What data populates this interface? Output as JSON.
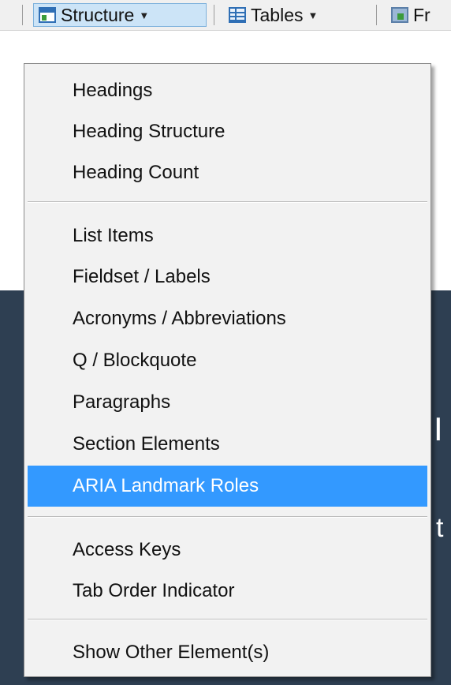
{
  "toolbar": {
    "structure_label": "Structure",
    "tables_label": "Tables",
    "frames_label_partial": "Fr"
  },
  "background": {
    "glyph_1": "I",
    "glyph_2": "t"
  },
  "menu": {
    "group1": [
      "Headings",
      "Heading Structure",
      "Heading Count"
    ],
    "group2": [
      "List Items",
      "Fieldset / Labels",
      "Acronyms / Abbreviations",
      "Q / Blockquote",
      "Paragraphs",
      "Section Elements",
      "ARIA Landmark Roles"
    ],
    "group3": [
      "Access Keys",
      "Tab Order Indicator"
    ],
    "group4": [
      "Show Other Element(s)"
    ],
    "selected": "ARIA Landmark Roles"
  },
  "colors": {
    "selection": "#3399ff",
    "active_button": "#cce4f7",
    "dark_band": "#2e3f52"
  }
}
